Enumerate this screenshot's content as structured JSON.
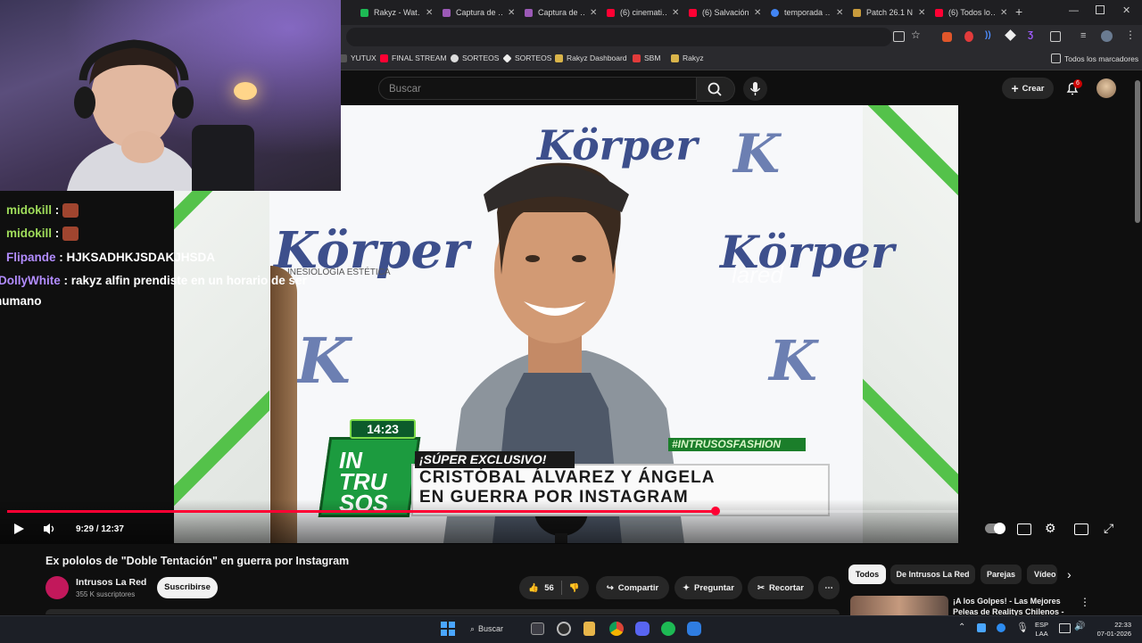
{
  "browser": {
    "tabs": [
      {
        "label": "Rakyz - Wat…",
        "color": "#1db954"
      },
      {
        "label": "Captura de …",
        "color": "#9b59b6"
      },
      {
        "label": "Captura de …",
        "color": "#9b59b6"
      },
      {
        "label": "(6) cinemati…",
        "color": "#ff0033"
      },
      {
        "label": "(6) Salvación…",
        "color": "#ff0033"
      },
      {
        "label": "temporada …",
        "color": "#4285f4"
      },
      {
        "label": "Patch 26.1 N…",
        "color": "#c89b3c"
      },
      {
        "label": "(6) Todos lo…",
        "color": "#ff0033"
      }
    ],
    "new_tab": "+",
    "bookmarks": [
      "YUTUX",
      "FINAL STREAM",
      "SORTEOS",
      "SORTEOS",
      "Rakyz Dashboard",
      "SBM",
      "Rakyz"
    ],
    "all_bookmarks": "Todos los marcadores"
  },
  "youtube": {
    "search_placeholder": "Buscar",
    "create_label": "Crear",
    "notif_count": "6"
  },
  "player": {
    "watermark": "lared",
    "clock": "14:23",
    "hashtag": "#INTRUSOSFASHION",
    "exclusive": "¡SÚPER EXCLUSIVO!",
    "headline_1": "CRISTÓBAL ÁLVAREZ Y ÁNGELA",
    "headline_2": "EN GUERRA POR INSTAGRAM",
    "show_logo": "IN TRU SOS",
    "backdrop_brand": "Körper",
    "backdrop_sub": "INESIOLOGÍA ESTÉTICA",
    "time": "9:29 / 12:37",
    "progress_fraction": 0.745
  },
  "chat": {
    "messages": [
      {
        "user": "midokill",
        "text": "",
        "color": "#9fdc5a"
      },
      {
        "user": "midokill",
        "text": "",
        "color": "#9fdc5a"
      },
      {
        "user": "Flipande",
        "text": "HJKSADHKJSDAKJHSDA",
        "color": "#b28cff"
      },
      {
        "user": "DollyWhite",
        "text": "rakyz alfin prendiste en un horario de ser",
        "color": "#b28cff"
      }
    ],
    "wrap": "humano"
  },
  "video": {
    "title": "Ex pololos de \"Doble Tentación\" en guerra por Instagram",
    "channel": "Intrusos La Red",
    "subscribers": "355 K suscriptores",
    "subscribe": "Suscribirse",
    "likes": "56",
    "share": "Compartir",
    "ask": "Preguntar",
    "clip": "Recortar"
  },
  "sidebar": {
    "chips": [
      "Todos",
      "De Intrusos La Red",
      "Parejas",
      "Vídeo"
    ],
    "first_reco": "¡A los Golpes! - Las Mejores Peleas de Realitys Chilenos -"
  },
  "taskbar": {
    "search": "Buscar",
    "lang_1": "ESP",
    "lang_2": "LAA",
    "time": "22:33",
    "date": "07-01-2026"
  }
}
